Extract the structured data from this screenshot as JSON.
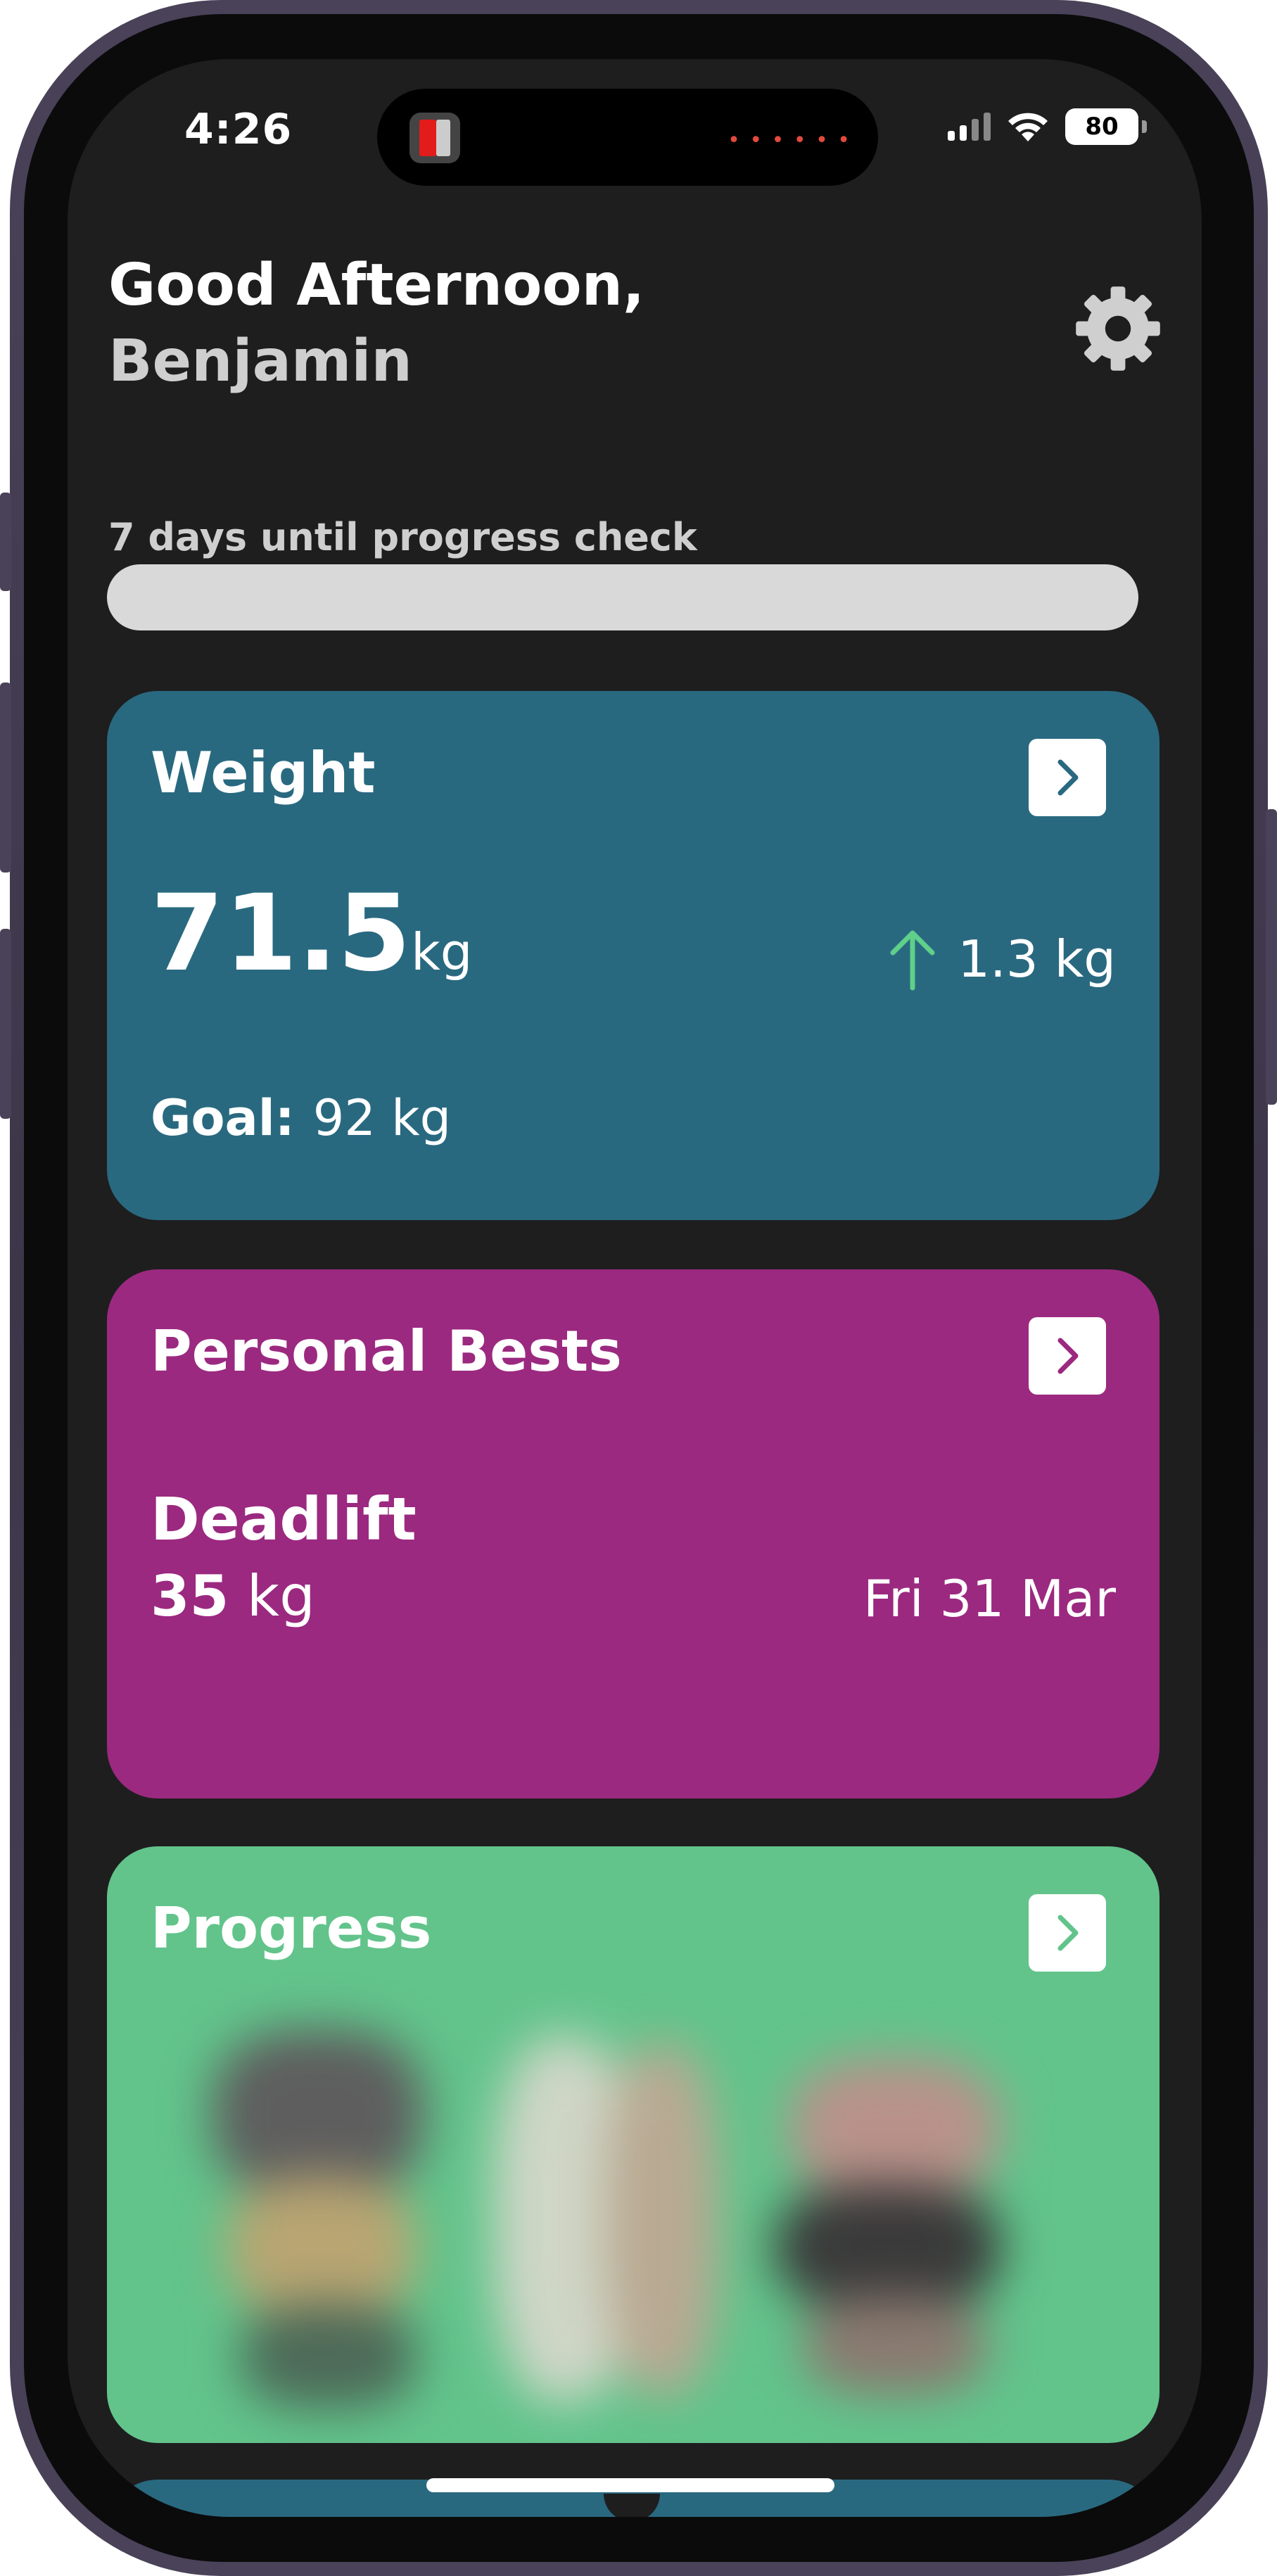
{
  "status_bar": {
    "time": "4:26",
    "battery": "80",
    "icons": [
      "app-icon",
      "signal-icon",
      "wifi-icon",
      "battery-icon"
    ]
  },
  "greeting": {
    "line1": "Good Afternoon,",
    "name": "Benjamin"
  },
  "settings": {
    "icon": "gear-icon"
  },
  "progress_check": {
    "label": "7 days until progress check",
    "fill_fraction": 0
  },
  "weight_card": {
    "title": "Weight",
    "value": "71.5",
    "unit": "kg",
    "change": "1.3 kg",
    "change_direction": "up",
    "goal_label": "Goal:",
    "goal_value": "92 kg",
    "color": "#296980"
  },
  "pb_card": {
    "title": "Personal Bests",
    "exercise": "Deadlift",
    "value": "35",
    "unit": "kg",
    "date": "Fri 31 Mar",
    "color": "#9b2980"
  },
  "progress_card": {
    "title": "Progress",
    "color": "#62c48b"
  },
  "colors": {
    "background": "#1e1e1f",
    "accent_up": "#5fcf8a"
  }
}
